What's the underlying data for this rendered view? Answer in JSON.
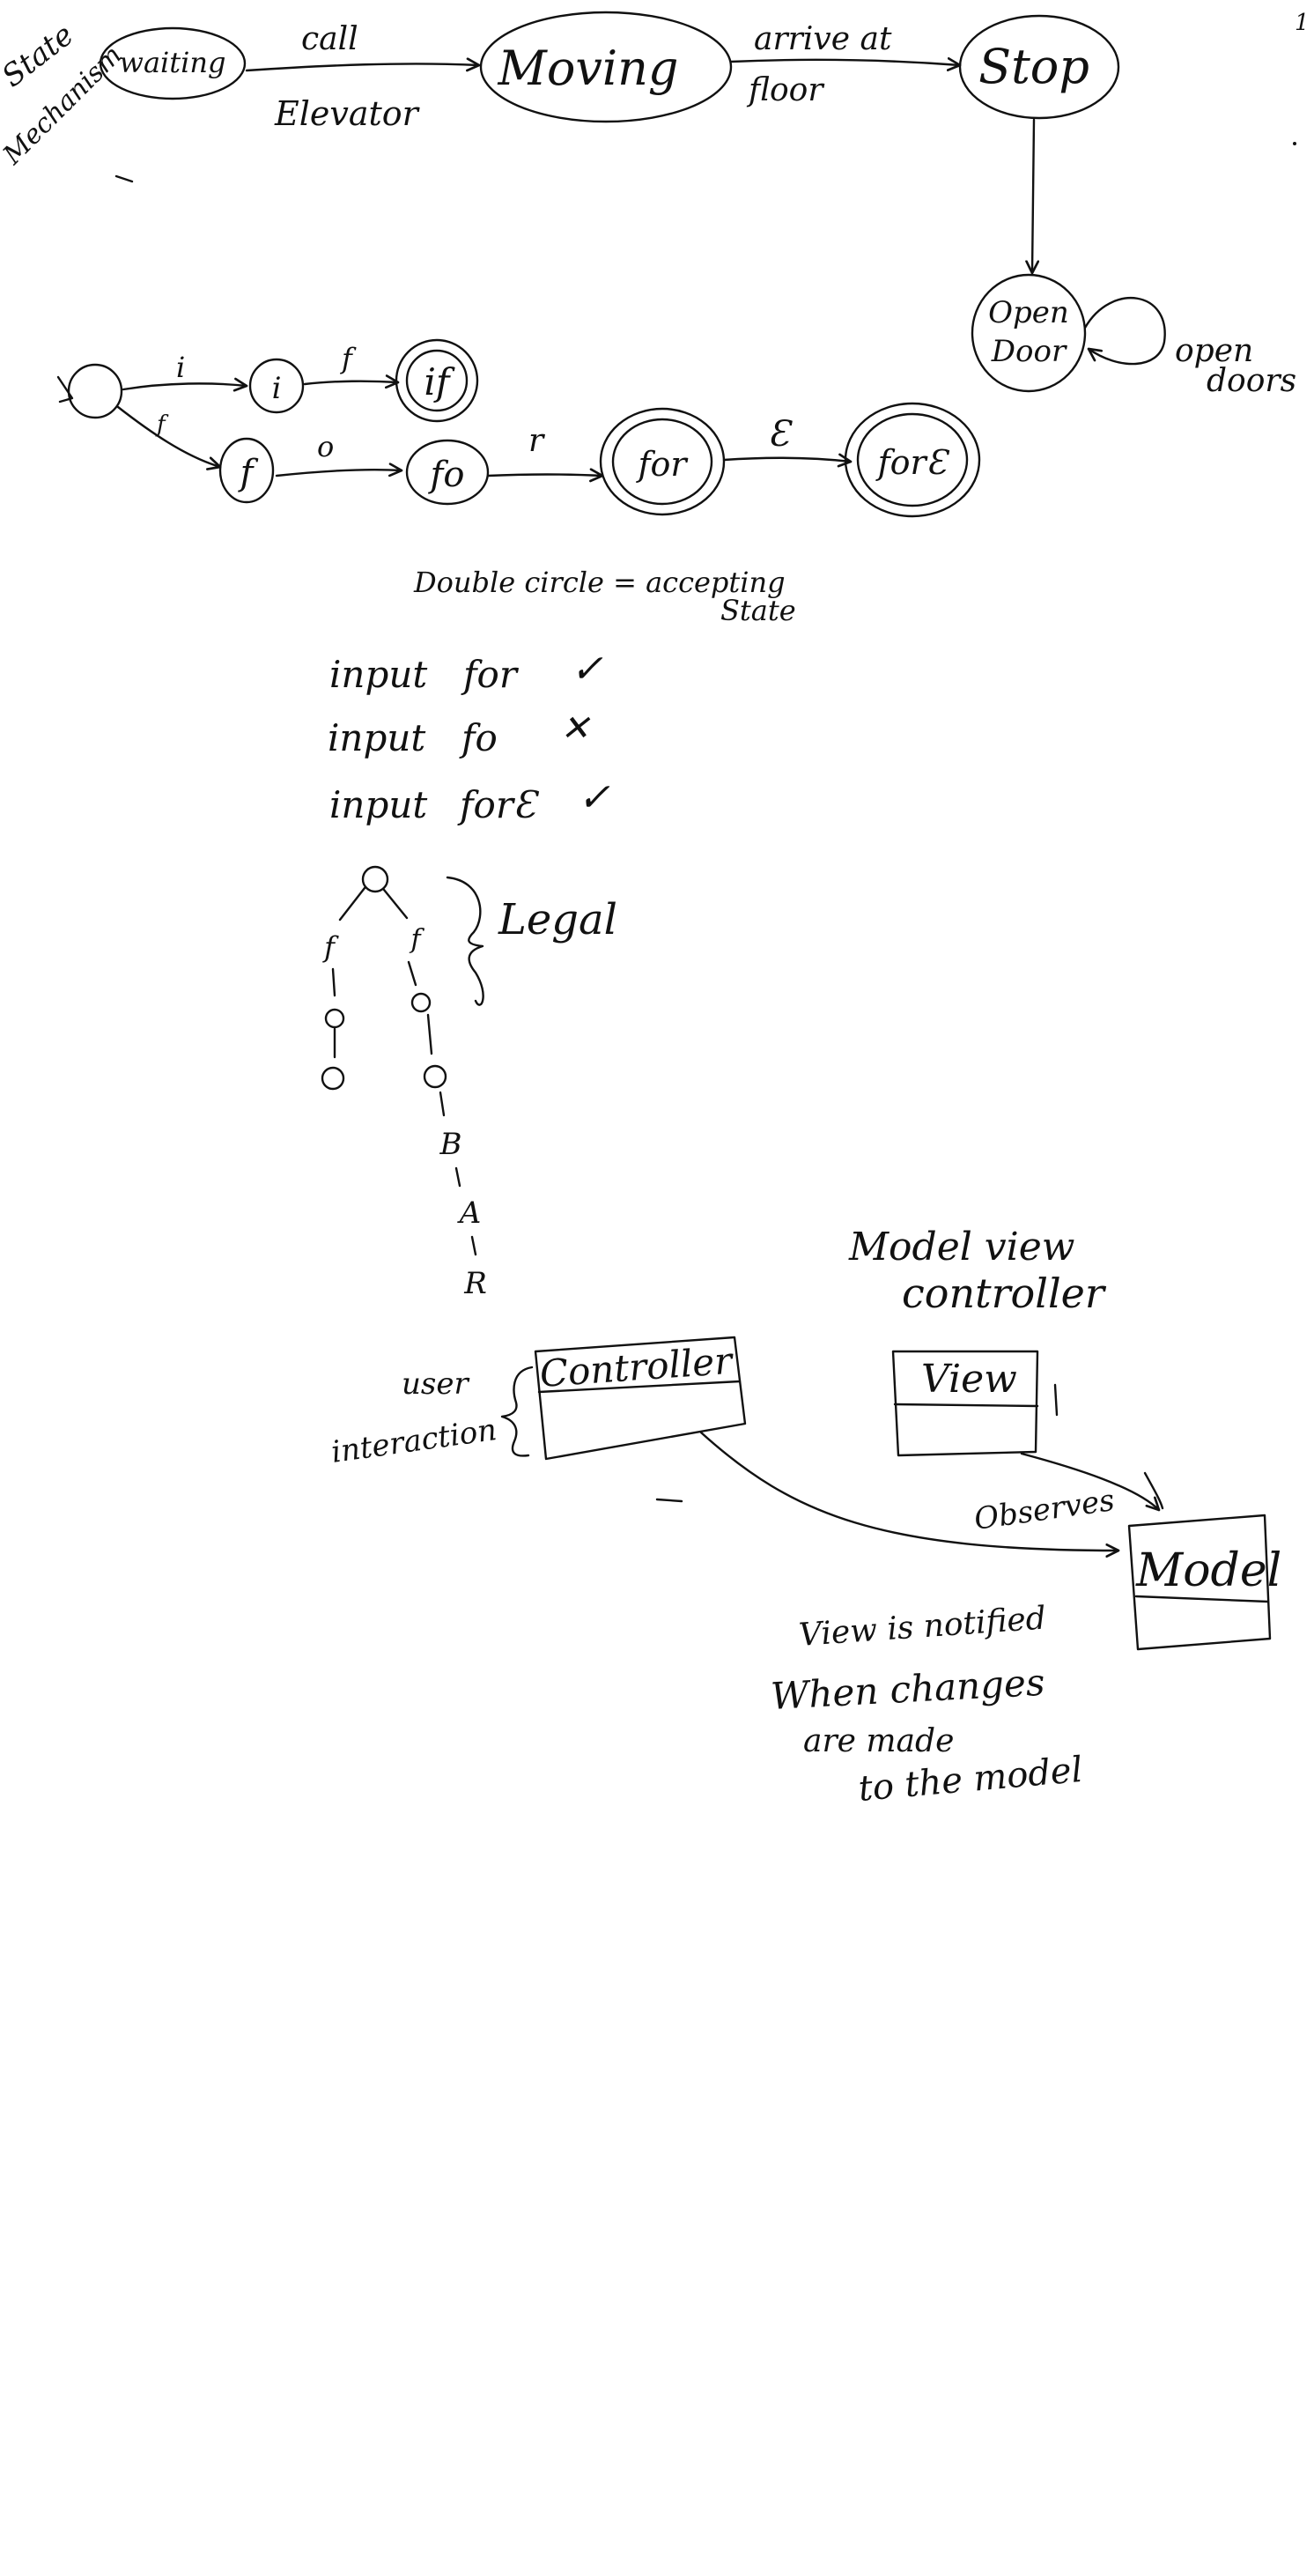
{
  "page": {
    "number": "1",
    "ink_color": "#111111",
    "background": "#ffffff"
  },
  "elevator": {
    "title_line1": "State",
    "title_line2": "Mechanism",
    "states": {
      "waiting": "waiting",
      "moving": "Moving",
      "stop": "Stop",
      "open_door_line1": "Open",
      "open_door_line2": "Door"
    },
    "transitions": {
      "call_line1": "call",
      "call_line2": "Elevator",
      "arrive_line1": "arrive at",
      "arrive_line2": "floor",
      "self_loop_line1": "open",
      "self_loop_line2": "doors"
    }
  },
  "automaton": {
    "states": {
      "i": "i",
      "if": "if",
      "f": "f",
      "fo": "fo",
      "for": "for",
      "forE": "forƐ"
    },
    "edges": {
      "i": "i",
      "f_top": "f",
      "f_low": "f",
      "o": "o",
      "r": "r",
      "E": "Ɛ"
    },
    "legend_line1": "Double circle = accepting",
    "legend_line2": "State"
  },
  "inputs": [
    {
      "prefix": "input",
      "word": "for",
      "mark": "✓"
    },
    {
      "prefix": "input",
      "word": "fo",
      "mark": "✕"
    },
    {
      "prefix": "input",
      "word": "forƐ",
      "mark": "✓"
    }
  ],
  "tree": {
    "left_label": "f",
    "right_label": "f",
    "letter_b": "B",
    "letter_a": "A",
    "letter_r": "R",
    "brace_label": "Legal"
  },
  "mvc": {
    "title_line1": "Model view",
    "title_line2": "controller",
    "controller": "Controller",
    "view": "View",
    "model": "Model",
    "observes": "Observes",
    "user_line1": "user",
    "user_line2": "interaction",
    "note_line1": "View is notified",
    "note_line2": "When changes",
    "note_line3": "are made",
    "note_line4": "to the model"
  }
}
